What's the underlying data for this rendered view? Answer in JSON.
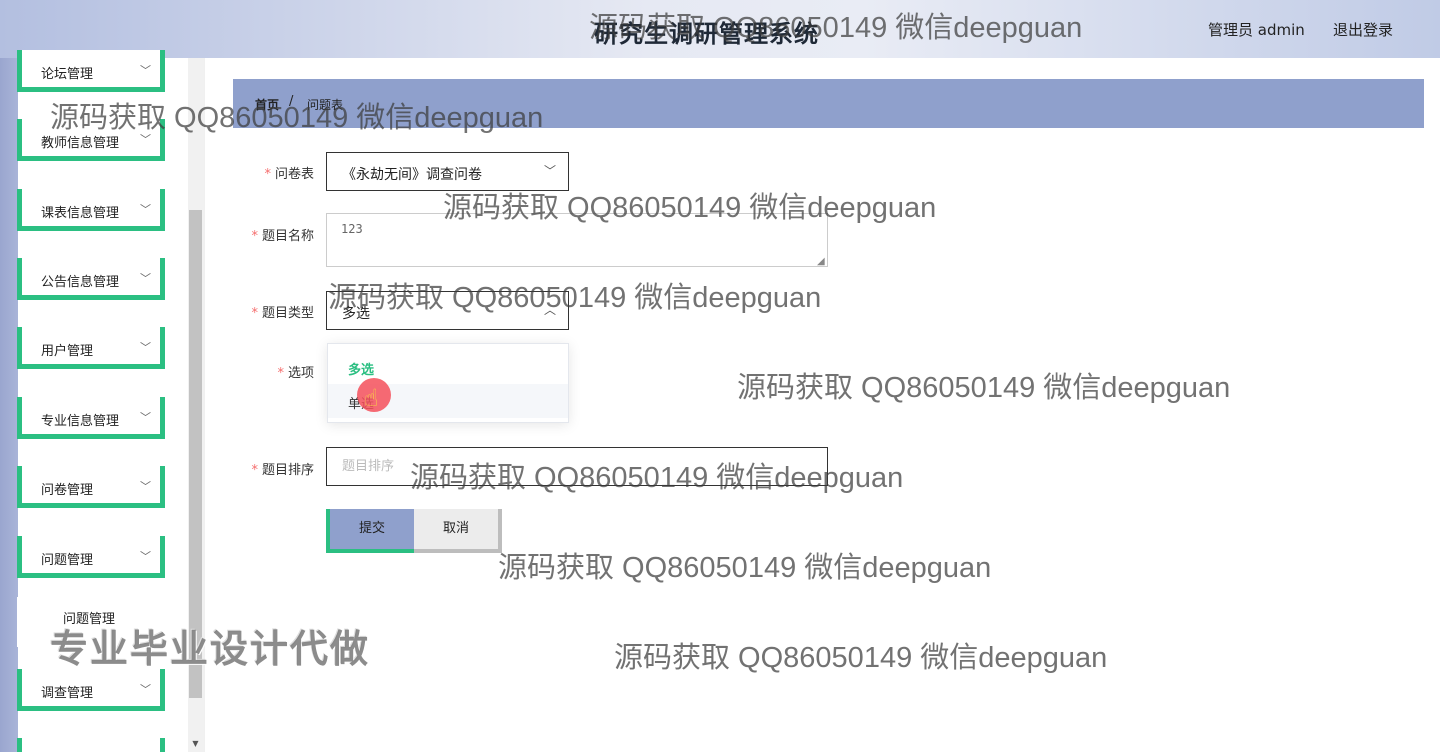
{
  "header": {
    "system_title": "研究生调研管理系统",
    "admin_label": "管理员 admin",
    "logout_label": "退出登录"
  },
  "sidebar": {
    "items": [
      {
        "label": "论坛管理"
      },
      {
        "label": "教师信息管理"
      },
      {
        "label": "课表信息管理"
      },
      {
        "label": "公告信息管理"
      },
      {
        "label": "用户管理"
      },
      {
        "label": "专业信息管理"
      },
      {
        "label": "问卷管理"
      },
      {
        "label": "问题管理"
      },
      {
        "label": "调查管理"
      }
    ],
    "subitem": {
      "label": "问题管理"
    },
    "chevron": "chevron-down-icon"
  },
  "breadcrumb": {
    "home": "首页",
    "separator": "/",
    "current": "问题表"
  },
  "form": {
    "questionnaire": {
      "label": "问卷表",
      "value": "《永劫无间》调查问卷"
    },
    "question_name": {
      "label": "题目名称",
      "value": "123"
    },
    "question_type": {
      "label": "题目类型",
      "value": "多选"
    },
    "options": {
      "label": "选项"
    },
    "question_order": {
      "label": "题目排序",
      "placeholder": "题目排序"
    },
    "dropdown_options": [
      {
        "label": "多选",
        "selected": true
      },
      {
        "label": "单选",
        "selected": false
      }
    ],
    "submit_label": "提交",
    "cancel_label": "取消",
    "required_mark": "*"
  },
  "watermarks": {
    "text": "源码获取 QQ86050149 微信deepguan",
    "big": "专业毕业设计代做"
  },
  "colors": {
    "accent_green": "#2bbf82",
    "header_blue": "#8fa0cc",
    "required_red": "#f56c6c"
  }
}
